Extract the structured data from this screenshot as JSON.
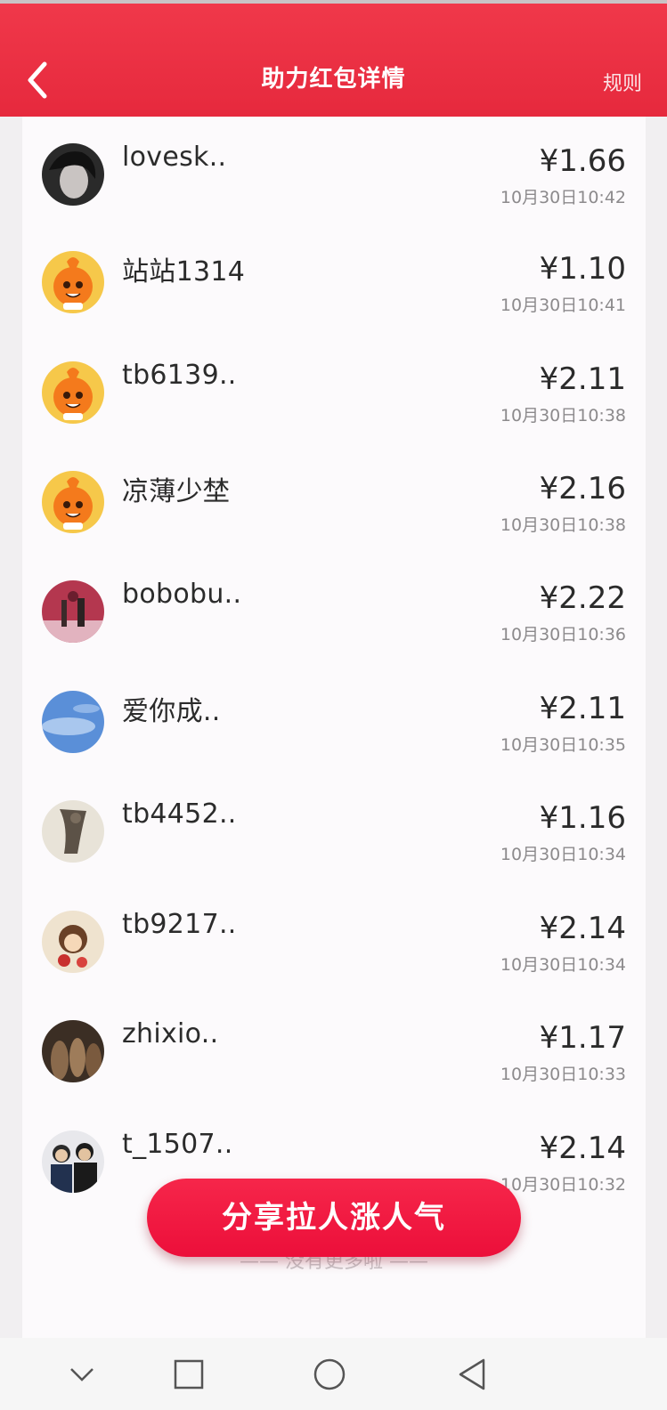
{
  "header": {
    "title": "助力红包详情",
    "rules_label": "规则",
    "back_icon": "chevron-left-icon",
    "color": "#e8303f"
  },
  "records": [
    {
      "name": "lovesk..",
      "amount": "¥1.66",
      "time": "10月30日10:42",
      "avatar": "dark-portrait"
    },
    {
      "name": "站站1314",
      "amount": "¥1.10",
      "time": "10月30日10:41",
      "avatar": "orange-mascot"
    },
    {
      "name": "tb6139..",
      "amount": "¥2.11",
      "time": "10月30日10:38",
      "avatar": "orange-mascot"
    },
    {
      "name": "凉薄少埜",
      "amount": "¥2.16",
      "time": "10月30日10:38",
      "avatar": "orange-mascot"
    },
    {
      "name": "bobobu..",
      "amount": "¥2.22",
      "time": "10月30日10:36",
      "avatar": "red-photo"
    },
    {
      "name": "爱你成..",
      "amount": "¥2.11",
      "time": "10月30日10:35",
      "avatar": "blue-sky"
    },
    {
      "name": "tb4452..",
      "amount": "¥1.16",
      "time": "10月30日10:34",
      "avatar": "sketch-photo"
    },
    {
      "name": "tb9217..",
      "amount": "¥2.14",
      "time": "10月30日10:34",
      "avatar": "cartoon-girl"
    },
    {
      "name": "zhixio..",
      "amount": "¥1.17",
      "time": "10月30日10:33",
      "avatar": "group-photo"
    },
    {
      "name": "t_1507..",
      "amount": "¥2.14",
      "time": "10月30日10:32",
      "avatar": "people-photo"
    }
  ],
  "end_note": "—— 没有更多啦 ——",
  "share_button": "分享拉人涨人气",
  "navbar": {
    "icons": [
      "chevron-down-icon",
      "square-icon",
      "circle-icon",
      "triangle-back-icon"
    ]
  }
}
